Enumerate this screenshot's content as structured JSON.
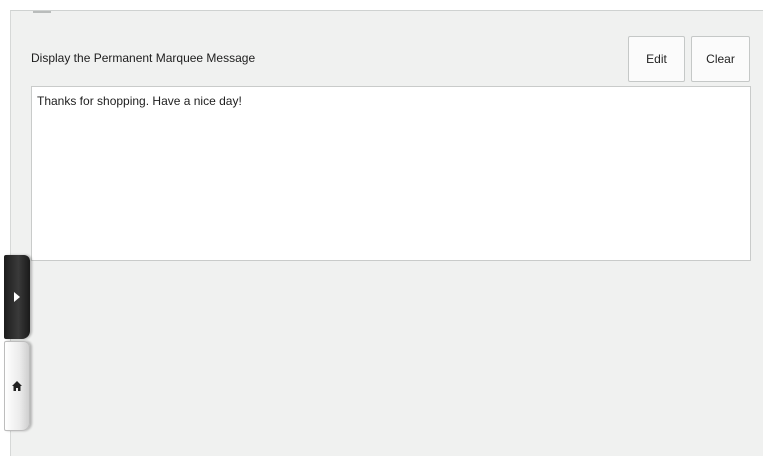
{
  "header": {
    "title": "Display the Permanent Marquee Message"
  },
  "toolbar": {
    "edit_label": "Edit",
    "clear_label": "Clear"
  },
  "message": {
    "value": "Thanks for shopping. Have a nice day!"
  },
  "side_tabs": {
    "expand_icon": "chevron-right-icon",
    "home_icon": "home-icon"
  },
  "colors": {
    "panel_background": "#f0f1f0",
    "tab_dark": "#1c1c1c",
    "tab_light": "#ececec"
  }
}
